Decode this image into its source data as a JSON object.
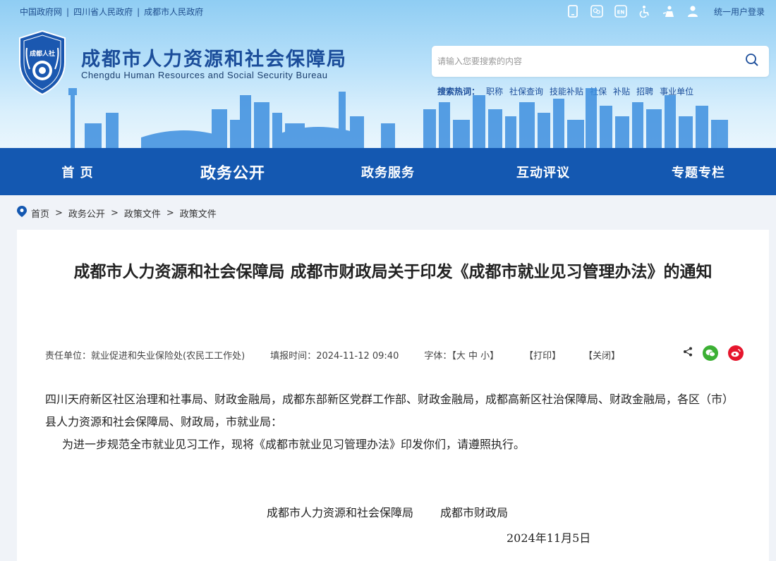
{
  "topbar": {
    "links": [
      "中国政府网",
      "四川省人民政府",
      "成都市人民政府"
    ],
    "login": "统一用户登录",
    "icons": [
      "mobile-icon",
      "wechat-icon",
      "english-icon",
      "accessibility-icon",
      "care-icon",
      "user-icon"
    ]
  },
  "brand": {
    "logo_text": "成都人社",
    "title": "成都市人力资源和社会保障局",
    "subtitle": "Chengdu Human Resources and Social Security Bureau"
  },
  "search": {
    "placeholder": "请输入您要搜索的内容",
    "hot_label": "搜索热词：",
    "hot_terms": [
      "职称",
      "社保查询",
      "技能补贴",
      "社保",
      "补贴",
      "招聘",
      "事业单位"
    ]
  },
  "nav": {
    "items": [
      "首 页",
      "政务公开",
      "政务服务",
      "互动评议",
      "专题专栏"
    ],
    "active_index": 1
  },
  "breadcrumb": [
    "首页",
    "政务公开",
    "政策文件",
    "政策文件"
  ],
  "article": {
    "title": "成都市人力资源和社会保障局 成都市财政局关于印发《成都市就业见习管理办法》的通知",
    "unit_label": "责任单位：",
    "unit": "就业促进和失业保险处(农民工工作处)",
    "time_label": "填报时间：",
    "time": "2024-11-12 09:40",
    "font_label": "字体：",
    "font_sizes": "【大 中 小】",
    "print": "【打印】",
    "close": "【关闭】",
    "recipients": "四川天府新区社区治理和社事局、财政金融局，成都东部新区党群工作部、财政金融局，成都高新区社治保障局、财政金融局，各区（市）县人力资源和社会保障局、财政局，市就业局：",
    "body": "为进一步规范全市就业见习工作，现将《成都市就业见习管理办法》印发你们，请遵照执行。",
    "signer1": "成都市人力资源和社会保障局",
    "signer2": "成都市财政局",
    "date": "2024年11月5日"
  },
  "colors": {
    "nav_bg": "#1458b1",
    "brand_blue": "#1b4d9a"
  }
}
